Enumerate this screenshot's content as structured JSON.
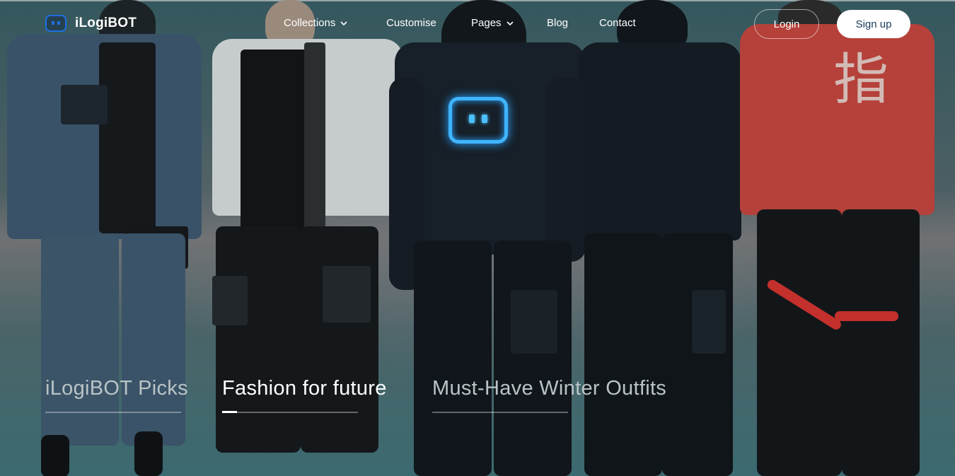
{
  "brand": {
    "name": "iLogiBOT",
    "accent": "#1e6fe0"
  },
  "nav": {
    "items": [
      {
        "label": "Collections",
        "has_dropdown": true
      },
      {
        "label": "Customise",
        "has_dropdown": false
      },
      {
        "label": "Pages",
        "has_dropdown": true
      },
      {
        "label": "Blog",
        "has_dropdown": false
      },
      {
        "label": "Contact",
        "has_dropdown": false
      }
    ],
    "login_label": "Login",
    "signup_label": "Sign up"
  },
  "hero": {
    "jacket_text": "指",
    "slides": [
      {
        "label": "iLogiBOT Picks",
        "active": false
      },
      {
        "label": "Fashion for future",
        "active": true
      },
      {
        "label": "Must-Have Winter Outfits",
        "active": false
      }
    ]
  },
  "colors": {
    "signup_text": "#1b3a5a",
    "bot_glow": "#3fb4ff",
    "active_tab": "#ffffff",
    "inactive_tab": "#b9c4c6"
  }
}
